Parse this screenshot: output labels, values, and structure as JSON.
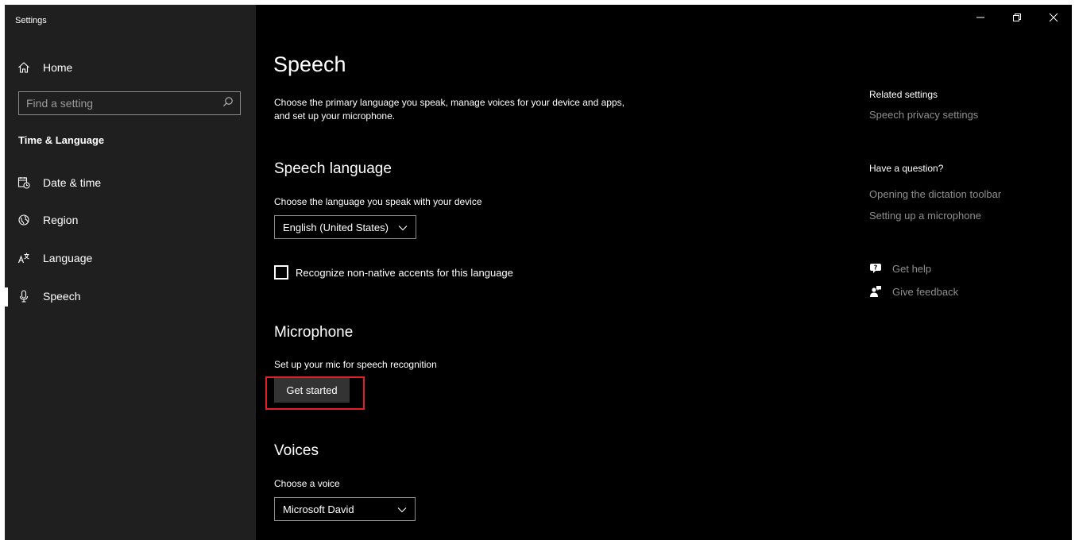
{
  "window": {
    "title": "Settings",
    "controls": {
      "minimize": "–",
      "restore": "❐",
      "close": "✕"
    }
  },
  "sidebar": {
    "home_label": "Home",
    "search_placeholder": "Find a setting",
    "section_heading": "Time & Language",
    "items": [
      {
        "label": "Date & time",
        "icon": "calendar-clock-icon"
      },
      {
        "label": "Region",
        "icon": "globe-icon"
      },
      {
        "label": "Language",
        "icon": "language-icon"
      },
      {
        "label": "Speech",
        "icon": "microphone-icon",
        "active": true
      }
    ]
  },
  "main": {
    "title": "Speech",
    "description": "Choose the primary language you speak, manage voices for your device and apps, and set up your microphone.",
    "speech_language": {
      "heading": "Speech language",
      "label": "Choose the language you speak with your device",
      "selected": "English (United States)",
      "checkbox_label": "Recognize non-native accents for this language",
      "checkbox_checked": false
    },
    "microphone": {
      "heading": "Microphone",
      "label": "Set up your mic for speech recognition",
      "button": "Get started"
    },
    "voices": {
      "heading": "Voices",
      "label": "Choose a voice",
      "selected": "Microsoft David"
    }
  },
  "right": {
    "related_heading": "Related settings",
    "related_links": [
      "Speech privacy settings"
    ],
    "question_heading": "Have a question?",
    "question_links": [
      "Opening the dictation toolbar",
      "Setting up a microphone"
    ],
    "actions": [
      {
        "label": "Get help",
        "icon": "help-chat-icon"
      },
      {
        "label": "Give feedback",
        "icon": "feedback-icon"
      }
    ]
  },
  "colors": {
    "background": "#000000",
    "sidebar": "#1f1f1f",
    "link": "#8f8f8f",
    "highlight": "#e21e26",
    "button": "#333333"
  }
}
